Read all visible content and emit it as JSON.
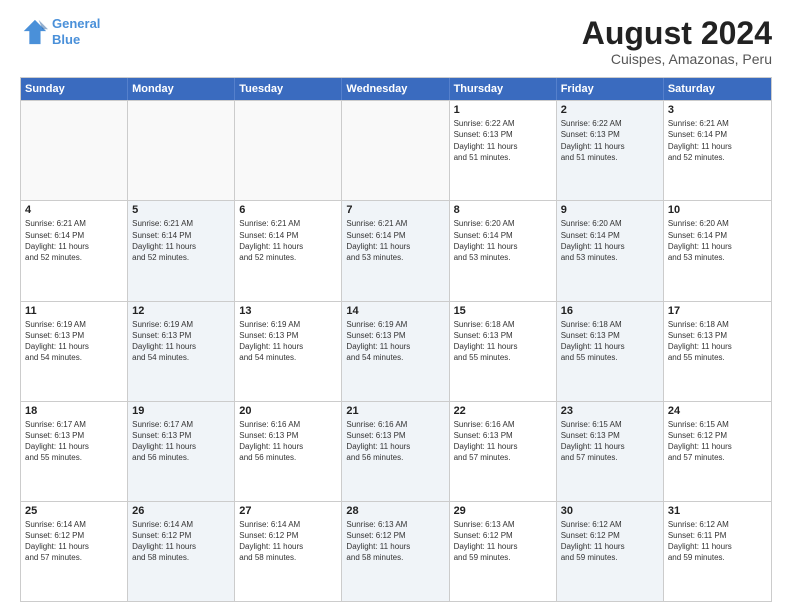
{
  "logo": {
    "line1": "General",
    "line2": "Blue"
  },
  "title": "August 2024",
  "subtitle": "Cuispes, Amazonas, Peru",
  "days_of_week": [
    "Sunday",
    "Monday",
    "Tuesday",
    "Wednesday",
    "Thursday",
    "Friday",
    "Saturday"
  ],
  "weeks": [
    [
      {
        "day": "",
        "info": "",
        "shaded": false
      },
      {
        "day": "",
        "info": "",
        "shaded": false
      },
      {
        "day": "",
        "info": "",
        "shaded": false
      },
      {
        "day": "",
        "info": "",
        "shaded": false
      },
      {
        "day": "1",
        "info": "Sunrise: 6:22 AM\nSunset: 6:13 PM\nDaylight: 11 hours\nand 51 minutes.",
        "shaded": false
      },
      {
        "day": "2",
        "info": "Sunrise: 6:22 AM\nSunset: 6:13 PM\nDaylight: 11 hours\nand 51 minutes.",
        "shaded": true
      },
      {
        "day": "3",
        "info": "Sunrise: 6:21 AM\nSunset: 6:14 PM\nDaylight: 11 hours\nand 52 minutes.",
        "shaded": false
      }
    ],
    [
      {
        "day": "4",
        "info": "Sunrise: 6:21 AM\nSunset: 6:14 PM\nDaylight: 11 hours\nand 52 minutes.",
        "shaded": false
      },
      {
        "day": "5",
        "info": "Sunrise: 6:21 AM\nSunset: 6:14 PM\nDaylight: 11 hours\nand 52 minutes.",
        "shaded": true
      },
      {
        "day": "6",
        "info": "Sunrise: 6:21 AM\nSunset: 6:14 PM\nDaylight: 11 hours\nand 52 minutes.",
        "shaded": false
      },
      {
        "day": "7",
        "info": "Sunrise: 6:21 AM\nSunset: 6:14 PM\nDaylight: 11 hours\nand 53 minutes.",
        "shaded": true
      },
      {
        "day": "8",
        "info": "Sunrise: 6:20 AM\nSunset: 6:14 PM\nDaylight: 11 hours\nand 53 minutes.",
        "shaded": false
      },
      {
        "day": "9",
        "info": "Sunrise: 6:20 AM\nSunset: 6:14 PM\nDaylight: 11 hours\nand 53 minutes.",
        "shaded": true
      },
      {
        "day": "10",
        "info": "Sunrise: 6:20 AM\nSunset: 6:14 PM\nDaylight: 11 hours\nand 53 minutes.",
        "shaded": false
      }
    ],
    [
      {
        "day": "11",
        "info": "Sunrise: 6:19 AM\nSunset: 6:13 PM\nDaylight: 11 hours\nand 54 minutes.",
        "shaded": false
      },
      {
        "day": "12",
        "info": "Sunrise: 6:19 AM\nSunset: 6:13 PM\nDaylight: 11 hours\nand 54 minutes.",
        "shaded": true
      },
      {
        "day": "13",
        "info": "Sunrise: 6:19 AM\nSunset: 6:13 PM\nDaylight: 11 hours\nand 54 minutes.",
        "shaded": false
      },
      {
        "day": "14",
        "info": "Sunrise: 6:19 AM\nSunset: 6:13 PM\nDaylight: 11 hours\nand 54 minutes.",
        "shaded": true
      },
      {
        "day": "15",
        "info": "Sunrise: 6:18 AM\nSunset: 6:13 PM\nDaylight: 11 hours\nand 55 minutes.",
        "shaded": false
      },
      {
        "day": "16",
        "info": "Sunrise: 6:18 AM\nSunset: 6:13 PM\nDaylight: 11 hours\nand 55 minutes.",
        "shaded": true
      },
      {
        "day": "17",
        "info": "Sunrise: 6:18 AM\nSunset: 6:13 PM\nDaylight: 11 hours\nand 55 minutes.",
        "shaded": false
      }
    ],
    [
      {
        "day": "18",
        "info": "Sunrise: 6:17 AM\nSunset: 6:13 PM\nDaylight: 11 hours\nand 55 minutes.",
        "shaded": false
      },
      {
        "day": "19",
        "info": "Sunrise: 6:17 AM\nSunset: 6:13 PM\nDaylight: 11 hours\nand 56 minutes.",
        "shaded": true
      },
      {
        "day": "20",
        "info": "Sunrise: 6:16 AM\nSunset: 6:13 PM\nDaylight: 11 hours\nand 56 minutes.",
        "shaded": false
      },
      {
        "day": "21",
        "info": "Sunrise: 6:16 AM\nSunset: 6:13 PM\nDaylight: 11 hours\nand 56 minutes.",
        "shaded": true
      },
      {
        "day": "22",
        "info": "Sunrise: 6:16 AM\nSunset: 6:13 PM\nDaylight: 11 hours\nand 57 minutes.",
        "shaded": false
      },
      {
        "day": "23",
        "info": "Sunrise: 6:15 AM\nSunset: 6:13 PM\nDaylight: 11 hours\nand 57 minutes.",
        "shaded": true
      },
      {
        "day": "24",
        "info": "Sunrise: 6:15 AM\nSunset: 6:12 PM\nDaylight: 11 hours\nand 57 minutes.",
        "shaded": false
      }
    ],
    [
      {
        "day": "25",
        "info": "Sunrise: 6:14 AM\nSunset: 6:12 PM\nDaylight: 11 hours\nand 57 minutes.",
        "shaded": false
      },
      {
        "day": "26",
        "info": "Sunrise: 6:14 AM\nSunset: 6:12 PM\nDaylight: 11 hours\nand 58 minutes.",
        "shaded": true
      },
      {
        "day": "27",
        "info": "Sunrise: 6:14 AM\nSunset: 6:12 PM\nDaylight: 11 hours\nand 58 minutes.",
        "shaded": false
      },
      {
        "day": "28",
        "info": "Sunrise: 6:13 AM\nSunset: 6:12 PM\nDaylight: 11 hours\nand 58 minutes.",
        "shaded": true
      },
      {
        "day": "29",
        "info": "Sunrise: 6:13 AM\nSunset: 6:12 PM\nDaylight: 11 hours\nand 59 minutes.",
        "shaded": false
      },
      {
        "day": "30",
        "info": "Sunrise: 6:12 AM\nSunset: 6:12 PM\nDaylight: 11 hours\nand 59 minutes.",
        "shaded": true
      },
      {
        "day": "31",
        "info": "Sunrise: 6:12 AM\nSunset: 6:11 PM\nDaylight: 11 hours\nand 59 minutes.",
        "shaded": false
      }
    ]
  ]
}
